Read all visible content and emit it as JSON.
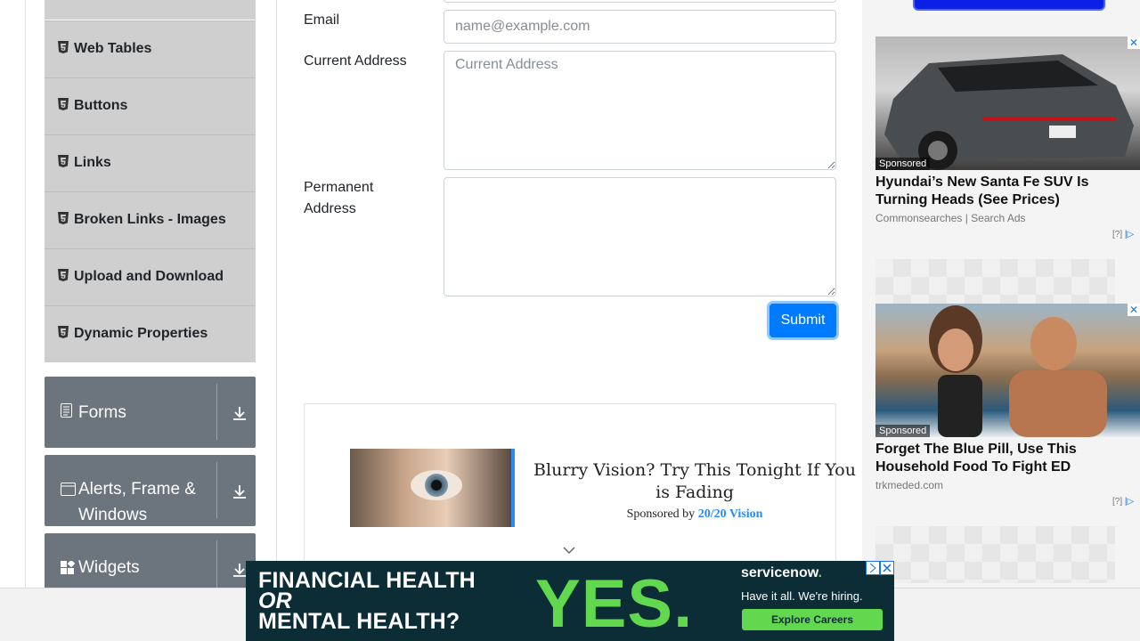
{
  "sidebar": {
    "subitems": [
      {
        "label": "Web Tables"
      },
      {
        "label": "Buttons"
      },
      {
        "label": "Links"
      },
      {
        "label": "Broken Links - Images"
      },
      {
        "label": "Upload and Download"
      },
      {
        "label": "Dynamic Properties"
      }
    ],
    "groups": [
      {
        "label": "Forms",
        "icon": "form-icon"
      },
      {
        "label": "Alerts, Frame & Windows",
        "icon": "window-icon"
      },
      {
        "label": "Widgets",
        "icon": "widgets-icon"
      }
    ]
  },
  "form": {
    "email_label": "Email",
    "email_placeholder": "name@example.com",
    "current_address_label": "Current Address",
    "current_address_placeholder": "Current Address",
    "permanent_address_label_line1": "Permanent",
    "permanent_address_label_line2": "Address",
    "submit_label": "Submit"
  },
  "inline_ad": {
    "title_line1": "Blurry Vision? Try This Tonight If You",
    "title_line2": "is Fading",
    "sponsored_prefix": "Sponsored by",
    "sponsor": "20/20 Vision"
  },
  "right_ads": [
    {
      "tag": "Sponsored",
      "headline": "Hyundai’s New Santa Fe SUV Is Turning Heads (See Prices)",
      "source": "Commonsearches | Search Ads",
      "meta": "[?]"
    },
    {
      "tag": "Sponsored",
      "headline": "Forget The Blue Pill, Use This Household Food To Fight ED",
      "source": "trkmeded.com",
      "meta": "[?]"
    }
  ],
  "banner": {
    "line1": "FINANCIAL HEALTH",
    "line2": "OR",
    "line3": "MENTAL HEALTH?",
    "yes": "YES.",
    "brand_main": "servicenow",
    "brand_dot": ".",
    "tagline": "Have it all. We're hiring.",
    "cta": "Explore Careers"
  },
  "colors": {
    "submit": "#007bff",
    "sidebar_group": "#6c757d",
    "sidebar_item": "#cfcfcf",
    "banner_bg": "#0c2d35",
    "banner_accent": "#62d84e"
  }
}
